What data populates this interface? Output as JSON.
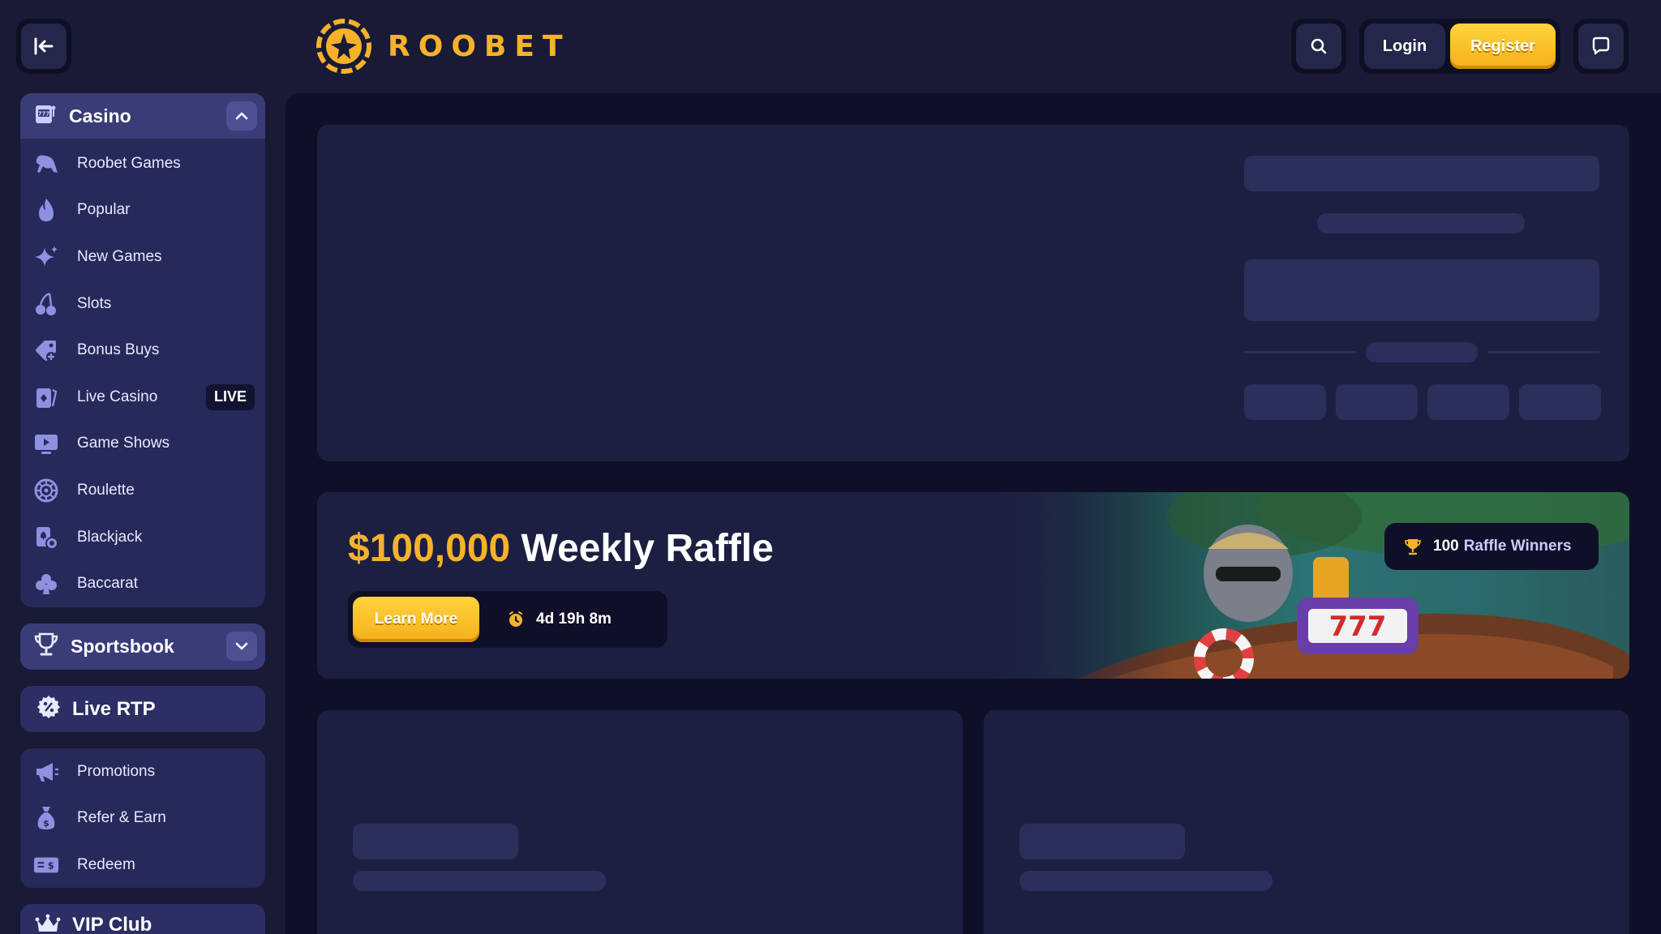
{
  "header": {
    "collapse_icon": "collapse-left-icon",
    "logo_text": "ROOBET",
    "search_icon": "search-icon",
    "login_label": "Login",
    "register_label": "Register",
    "chat_icon": "chat-icon"
  },
  "sidebar": {
    "casino": {
      "title": "Casino",
      "items": [
        {
          "label": "Roobet Games",
          "icon": "kangaroo-icon"
        },
        {
          "label": "Popular",
          "icon": "flame-icon"
        },
        {
          "label": "New Games",
          "icon": "sparkles-icon"
        },
        {
          "label": "Slots",
          "icon": "cherries-icon"
        },
        {
          "label": "Bonus Buys",
          "icon": "tag-icon"
        },
        {
          "label": "Live Casino",
          "icon": "cards-icon",
          "badge": "LIVE"
        },
        {
          "label": "Game Shows",
          "icon": "tv-icon"
        },
        {
          "label": "Roulette",
          "icon": "roulette-icon"
        },
        {
          "label": "Blackjack",
          "icon": "blackjack-icon"
        },
        {
          "label": "Baccarat",
          "icon": "club-icon"
        }
      ]
    },
    "sportsbook": {
      "title": "Sportsbook"
    },
    "live_rtp": {
      "title": "Live RTP"
    },
    "extras": [
      {
        "label": "Promotions",
        "icon": "megaphone-icon"
      },
      {
        "label": "Refer & Earn",
        "icon": "money-bag-icon"
      },
      {
        "label": "Redeem",
        "icon": "ticket-icon"
      }
    ],
    "vip": {
      "title": "VIP Club"
    }
  },
  "raffle": {
    "amount": "$100,000",
    "title": "Weekly Raffle",
    "learn_more": "Learn More",
    "countdown": "4d 19h 8m",
    "winners_count": "100",
    "winners_label": "Raffle Winners"
  },
  "colors": {
    "background": "#181a36",
    "accent": "#f5b22a",
    "panel": "#27295a"
  }
}
